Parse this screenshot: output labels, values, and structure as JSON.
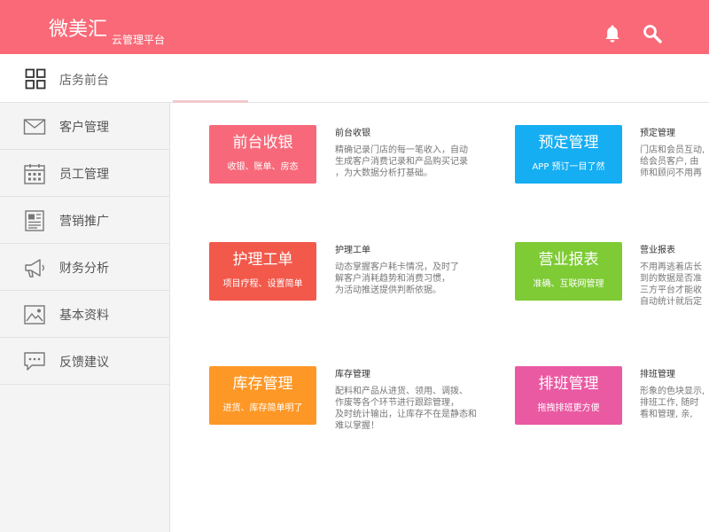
{
  "header": {
    "brand": "微美汇",
    "brand_sub": "云管理平台",
    "bg_color": "#f96977"
  },
  "topbar": {
    "label": "店务前台",
    "icon": "grid-icon"
  },
  "sidebar": {
    "items": [
      {
        "label": "客户管理",
        "icon": "mail-icon"
      },
      {
        "label": "员工管理",
        "icon": "calendar-icon"
      },
      {
        "label": "营销推广",
        "icon": "newspaper-icon"
      },
      {
        "label": "财务分析",
        "icon": "megaphone-icon"
      },
      {
        "label": "基本资料",
        "icon": "image-icon"
      },
      {
        "label": "反馈建议",
        "icon": "chat-bubble-icon"
      }
    ]
  },
  "modules": [
    {
      "title": "前台收银",
      "subtitle": "收银、账单、房态",
      "color": "#f7697a",
      "desc_title": "前台收银",
      "desc": "精确记录门店的每一笔收入，自动\n生成客户消费记录和产品购买记录\n，为大数据分析打基础。"
    },
    {
      "title": "预定管理",
      "subtitle": "APP 预订一目了然",
      "color": "#16aef2",
      "desc_title": "预定管理",
      "desc": "门店和会员互动,\n给会员客户, 由\n师和顾问不用再"
    },
    {
      "title": "护理工单",
      "subtitle": "项目疗程、设置简单",
      "color": "#f2594b",
      "desc_title": "护理工单",
      "desc": "动态掌握客户耗卡情况，及时了\n解客户消耗趋势和消费习惯，\n为活动推送提供判断依据。"
    },
    {
      "title": "营业报表",
      "subtitle": "准确、互联网管理",
      "color": "#7ecb35",
      "desc_title": "营业报表",
      "desc": "不用再逃着店长\n到的数据是否准\n三方平台才能收\n自动统计就后定"
    },
    {
      "title": "库存管理",
      "subtitle": "进货、库存简单明了",
      "color": "#fd9827",
      "desc_title": "库存管理",
      "desc": "配料和产品从进货、领用、调拨、\n作废等各个环节进行跟踪管理，\n及时统计输出，让库存不在是静态和\n难以掌握！"
    },
    {
      "title": "排班管理",
      "subtitle": "拖拽排班更方便",
      "color": "#ea5aa3",
      "desc_title": "排班管理",
      "desc": "形象的色块显示,\n排班工作, 随时\n看和管理, 亲,"
    }
  ]
}
